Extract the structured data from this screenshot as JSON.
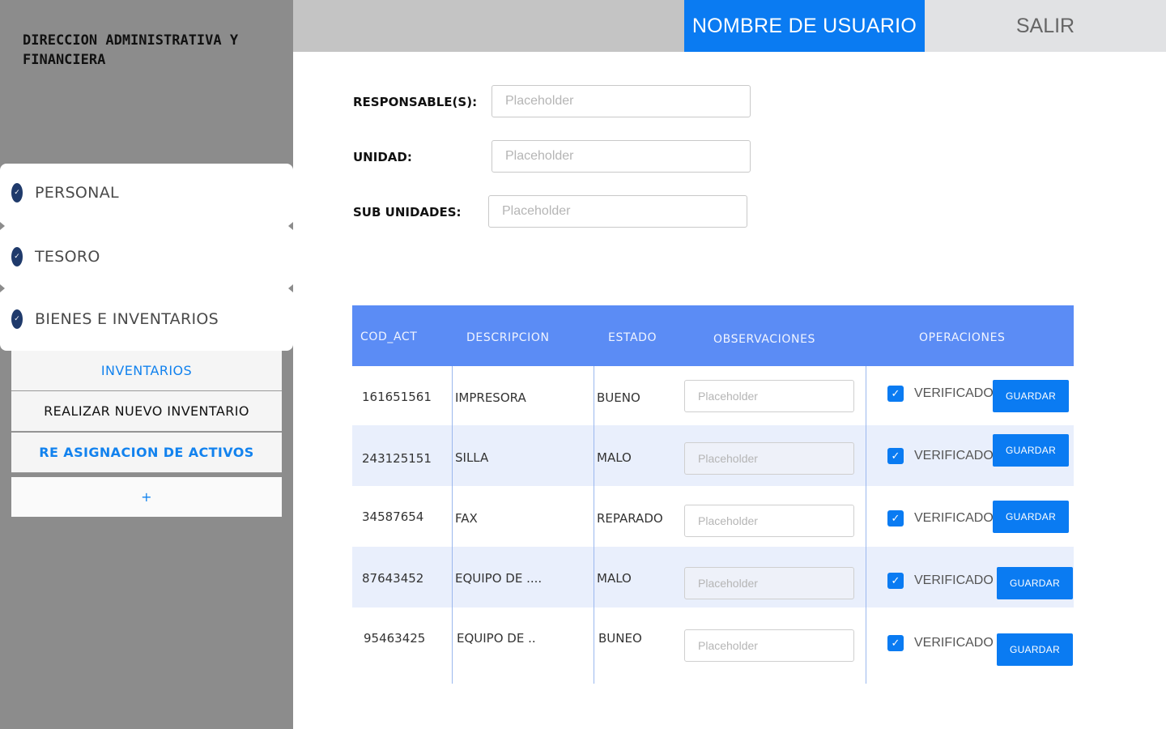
{
  "sidebar": {
    "brand": "DIRECCION ADMINISTRATIVA Y FINANCIERA",
    "menu": [
      {
        "label": "PERSONAL",
        "icon": "check-circle-icon"
      },
      {
        "label": "TESORO",
        "icon": "check-circle-icon"
      },
      {
        "label": "BIENES E INVENTARIOS",
        "icon": "check-circle-icon"
      }
    ],
    "submenu": {
      "inventarios": "INVENTARIOS",
      "nuevo": "REALIZAR NUEVO INVENTARIO",
      "reasignacion": "RE ASIGNACION DE ACTIVOS",
      "add": "+"
    }
  },
  "header": {
    "username": "NOMBRE DE USUARIO",
    "logout": "SALIR"
  },
  "form": {
    "responsables_label": "RESPONSABLE(S):",
    "responsables_placeholder": "Placeholder",
    "unidad_label": "UNIDAD:",
    "unidad_placeholder": "Placeholder",
    "subunidades_label": "SUB UNIDADES:",
    "subunidades_placeholder": "Placeholder"
  },
  "table": {
    "headers": {
      "cod": "COD_ACT",
      "desc": "DESCRIPCION",
      "estado": "ESTADO",
      "obs": "OBSERVACIONES",
      "ops": "OPERACIONES"
    },
    "rows": [
      {
        "cod": "161651561",
        "desc": "IMPRESORA",
        "estado": "BUENO",
        "obs_placeholder": "Placeholder",
        "verified": "VERIFICADO",
        "save": "GUARDAR"
      },
      {
        "cod": "243125151",
        "desc": "SILLA",
        "estado": "MALO",
        "obs_placeholder": "Placeholder",
        "verified": "VERIFICADO",
        "save": "GUARDAR"
      },
      {
        "cod": "34587654",
        "desc": "FAX",
        "estado": "REPARADO",
        "obs_placeholder": "Placeholder",
        "verified": "VERIFICADO",
        "save": "GUARDAR"
      },
      {
        "cod": "87643452",
        "desc": "EQUIPO DE ....",
        "estado": "MALO",
        "obs_placeholder": "Placeholder",
        "verified": "VERIFICADO",
        "save": "GUARDAR"
      },
      {
        "cod": "95463425",
        "desc": "EQUIPO DE ..",
        "estado": "BUNEO",
        "obs_placeholder": "Placeholder",
        "verified": "VERIFICADO",
        "save": "GUARDAR"
      }
    ]
  },
  "colors": {
    "accent": "#0a7bf2",
    "table_header": "#5b8cf5",
    "sidebar": "#8c8c8c",
    "topbar": "#c4c4c4"
  }
}
